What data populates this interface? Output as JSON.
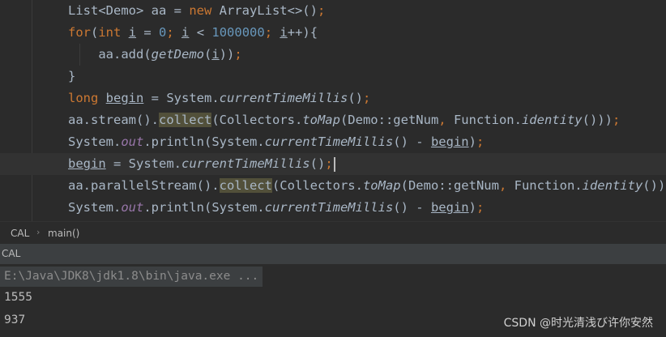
{
  "editor": {
    "lines": [
      [
        {
          "t": "List<Demo> aa = "
        },
        {
          "t": "new",
          "c": "kw"
        },
        {
          "t": " ArrayList<>()"
        },
        {
          "t": ";",
          "c": "kw"
        }
      ],
      [
        {
          "t": "for",
          "c": "kw"
        },
        {
          "t": "("
        },
        {
          "t": "int",
          "c": "kw"
        },
        {
          "t": " "
        },
        {
          "t": "i",
          "c": "ul"
        },
        {
          "t": " = "
        },
        {
          "t": "0",
          "c": "num"
        },
        {
          "t": "; ",
          "c": "kw"
        },
        {
          "t": "i",
          "c": "ul"
        },
        {
          "t": " < "
        },
        {
          "t": "1000000",
          "c": "num"
        },
        {
          "t": "; ",
          "c": "kw"
        },
        {
          "t": "i",
          "c": "ul"
        },
        {
          "t": "++){"
        }
      ],
      [
        {
          "t": "    aa.add("
        },
        {
          "t": "getDemo",
          "c": "it"
        },
        {
          "t": "("
        },
        {
          "t": "i",
          "c": "ul"
        },
        {
          "t": "))"
        },
        {
          "t": ";",
          "c": "kw"
        }
      ],
      [
        {
          "t": "}"
        }
      ],
      [
        {
          "t": "long",
          "c": "kw"
        },
        {
          "t": " "
        },
        {
          "t": "begin",
          "c": "ul"
        },
        {
          "t": " = System."
        },
        {
          "t": "currentTimeMillis",
          "c": "it"
        },
        {
          "t": "()"
        },
        {
          "t": ";",
          "c": "kw"
        }
      ],
      [
        {
          "t": "aa.stream()."
        },
        {
          "t": "collect",
          "c": "hl"
        },
        {
          "t": "(Collectors."
        },
        {
          "t": "toMap",
          "c": "it"
        },
        {
          "t": "(Demo::getNum"
        },
        {
          "t": ", ",
          "c": "kw"
        },
        {
          "t": "Function."
        },
        {
          "t": "identity",
          "c": "it"
        },
        {
          "t": "()))"
        },
        {
          "t": ";",
          "c": "kw"
        }
      ],
      [
        {
          "t": "System."
        },
        {
          "t": "out",
          "c": "st"
        },
        {
          "t": ".println(System."
        },
        {
          "t": "currentTimeMillis",
          "c": "it"
        },
        {
          "t": "() - "
        },
        {
          "t": "begin",
          "c": "ul"
        },
        {
          "t": ")"
        },
        {
          "t": ";",
          "c": "kw"
        }
      ],
      [
        {
          "t": "begin",
          "c": "ul"
        },
        {
          "t": " = System."
        },
        {
          "t": "currentTimeMillis",
          "c": "it"
        },
        {
          "t": "()"
        },
        {
          "t": ";",
          "c": "kw"
        },
        {
          "t": "",
          "c": "caret"
        }
      ],
      [
        {
          "t": "aa.parallelStream()."
        },
        {
          "t": "collect",
          "c": "hl"
        },
        {
          "t": "(Collectors."
        },
        {
          "t": "toMap",
          "c": "it"
        },
        {
          "t": "(Demo::getNum"
        },
        {
          "t": ", ",
          "c": "kw"
        },
        {
          "t": "Function."
        },
        {
          "t": "identity",
          "c": "it"
        },
        {
          "t": "()))"
        },
        {
          "t": ";",
          "c": "kw"
        }
      ],
      [
        {
          "t": "System."
        },
        {
          "t": "out",
          "c": "st"
        },
        {
          "t": ".println(System."
        },
        {
          "t": "currentTimeMillis",
          "c": "it"
        },
        {
          "t": "() - "
        },
        {
          "t": "begin",
          "c": "ul"
        },
        {
          "t": ")"
        },
        {
          "t": ";",
          "c": "kw"
        }
      ]
    ]
  },
  "breadcrumb": {
    "class_name": "CAL",
    "separator": "›",
    "method": "main()"
  },
  "run_panel": {
    "tab_label": "CAL"
  },
  "console": {
    "command": "E:\\Java\\JDK8\\jdk1.8\\bin\\java.exe ...",
    "outputs": [
      "1555",
      "937"
    ]
  },
  "watermark": "CSDN @时光清浅び许你安然",
  "colors": {
    "background": "#2b2b2b",
    "keyword": "#cc7832",
    "number": "#6897bb",
    "static_field": "#9876aa",
    "text": "#a9b7c6",
    "highlight": "#52503a"
  }
}
